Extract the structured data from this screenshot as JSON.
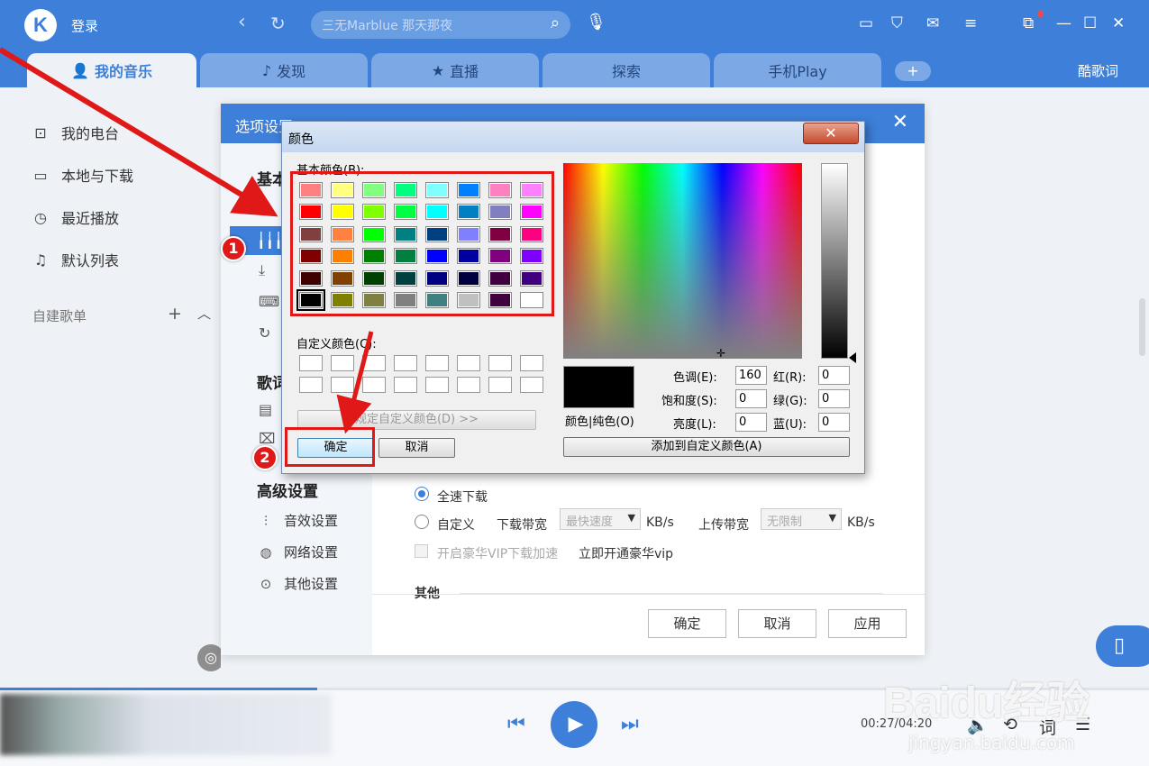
{
  "app": {
    "logo_letter": "K",
    "login": "登录",
    "search_placeholder": "三无Marblue 那天那夜",
    "lyrics_button": "酷歌词",
    "tabs": [
      {
        "label": "我的音乐",
        "icon": "👤"
      },
      {
        "label": "发现",
        "icon": "♪"
      },
      {
        "label": "直播",
        "icon": "★"
      },
      {
        "label": "探索",
        "icon": ""
      },
      {
        "label": "手机Play",
        "icon": ""
      }
    ]
  },
  "sidebar": {
    "items": [
      {
        "label": "我的电台",
        "icon": "radio-icon"
      },
      {
        "label": "本地与下载",
        "icon": "monitor-icon"
      },
      {
        "label": "最近播放",
        "icon": "clock-icon"
      },
      {
        "label": "默认列表",
        "icon": "playlist-icon"
      }
    ],
    "section": "自建歌单"
  },
  "options": {
    "title": "选项设置",
    "sections": {
      "basic": "基本",
      "lyrics": "歌词",
      "advanced": "高级设置"
    },
    "advanced_items": [
      "音效设置",
      "网络设置",
      "其他设置"
    ],
    "download": {
      "full_speed": "全速下载",
      "custom": "自定义",
      "download_bw": "下载带宽",
      "download_val": "最快速度",
      "unit": "KB/s",
      "upload_bw": "上传带宽",
      "upload_val": "无限制",
      "vip_accel": "开启豪华VIP下载加速",
      "vip_link": "立即开通豪华vip"
    },
    "other_label": "其他",
    "buttons": {
      "ok": "确定",
      "cancel": "取消",
      "apply": "应用"
    }
  },
  "color_dialog": {
    "title": "颜色",
    "basic_label": "基本颜色(B):",
    "custom_label": "自定义颜色(C):",
    "define_button": "规定自定义颜色(D) >>",
    "ok": "确定",
    "cancel": "取消",
    "color_solid": "颜色|纯色(O)",
    "add_custom": "添加到自定义颜色(A)",
    "fields": {
      "hue": {
        "label": "色调(E):",
        "value": "160"
      },
      "sat": {
        "label": "饱和度(S):",
        "value": "0"
      },
      "lum": {
        "label": "亮度(L):",
        "value": "0"
      },
      "red": {
        "label": "红(R):",
        "value": "0"
      },
      "green": {
        "label": "绿(G):",
        "value": "0"
      },
      "blue": {
        "label": "蓝(U):",
        "value": "0"
      }
    },
    "basic_colors": [
      [
        "#ff8080",
        "#ffff80",
        "#80ff80",
        "#00ff80",
        "#80ffff",
        "#0080ff",
        "#ff80c0",
        "#ff80ff"
      ],
      [
        "#ff0000",
        "#ffff00",
        "#80ff00",
        "#00ff40",
        "#00ffff",
        "#0080c0",
        "#8080c0",
        "#ff00ff"
      ],
      [
        "#804040",
        "#ff8040",
        "#00ff00",
        "#008080",
        "#004080",
        "#8080ff",
        "#800040",
        "#ff0080"
      ],
      [
        "#800000",
        "#ff8000",
        "#008000",
        "#008040",
        "#0000ff",
        "#0000a0",
        "#800080",
        "#8000ff"
      ],
      [
        "#400000",
        "#804000",
        "#004000",
        "#004040",
        "#000080",
        "#000040",
        "#400040",
        "#400080"
      ],
      [
        "#000000",
        "#808000",
        "#808040",
        "#808080",
        "#408080",
        "#c0c0c0",
        "#400040",
        "#ffffff"
      ]
    ],
    "selected_color": "#000000"
  },
  "annotations": {
    "step1": "1",
    "step2": "2",
    "color": "#e01818"
  },
  "player": {
    "time": "00:27/04:20"
  },
  "watermark": {
    "brand": "Baidu经验",
    "url": "jingyan.baidu.com"
  }
}
